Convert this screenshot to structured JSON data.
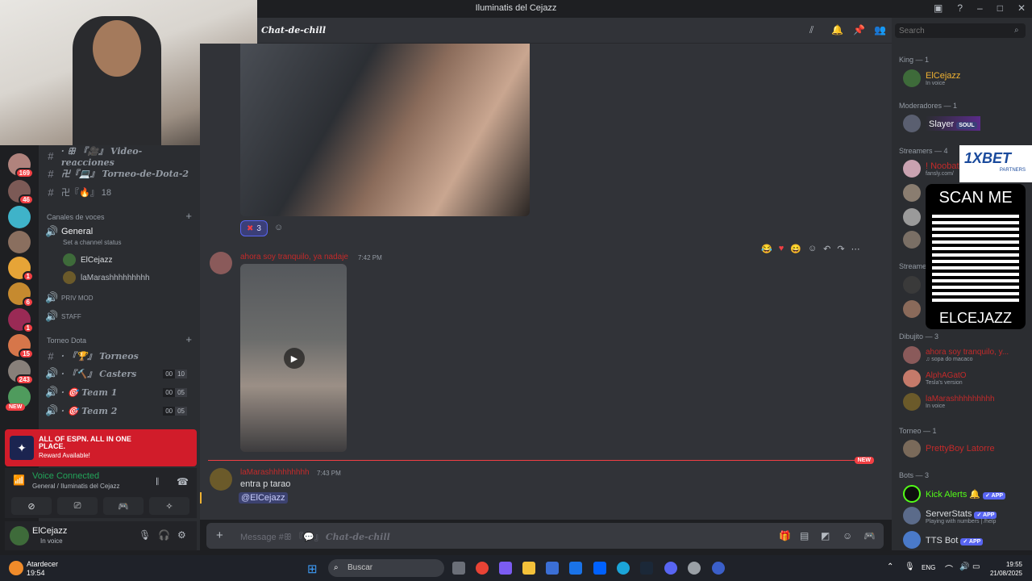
{
  "window": {
    "title": "Iluminatis del Cejazz"
  },
  "channel": {
    "name": "Chat-de-chill"
  },
  "search": {
    "placeholder": "Search"
  },
  "channels": {
    "top": [
      {
        "label": "· ꕥ 『🎥』 Video-reacciones"
      },
      {
        "label": "卍『💻』 Torneo-de-Dota-2"
      },
      {
        "label": "卍『🔥』 18"
      }
    ],
    "voice_category": "Canales de voces",
    "general": {
      "label": "General",
      "status": "Set a channel status"
    },
    "voice_users": [
      "ElCejazz",
      "laMarashhhhhhhhh"
    ],
    "priv_mod": "PRIV MOD",
    "staff": "STAFF",
    "dota_category": "Torneo Dota",
    "dota": [
      {
        "label": "· 『🏆』 Torneos",
        "count": null
      },
      {
        "label": "· 『🔨』 Casters",
        "count": [
          "00",
          "10"
        ]
      },
      {
        "label": "· 🎯 Team 1",
        "count": [
          "00",
          "05"
        ]
      },
      {
        "label": "· 🎯 Team 2",
        "count": [
          "00",
          "05"
        ]
      }
    ]
  },
  "servers": {
    "badges": [
      "169",
      "46",
      "1",
      "6",
      "1",
      "15",
      "243"
    ],
    "new_label": "NEW"
  },
  "espn": {
    "line1": "ALL OF ESPN. ALL IN ONE PLACE.",
    "line2": "Reward Available!"
  },
  "voice": {
    "status": "Voice Connected",
    "location": "General / Iluminatis del Cejazz"
  },
  "user": {
    "name": "ElCejazz",
    "status": "In voice"
  },
  "messages": {
    "reaction_count": "3",
    "msg1": {
      "author": "ahora soy tranquilo, ya nadaje",
      "time": "7:42 PM"
    },
    "msg2": {
      "author": "laMarashhhhhhhhh",
      "time": "7:43 PM",
      "text": "entra p tarao",
      "mention": "@ElCejazz"
    },
    "new_label": "NEW"
  },
  "composer": {
    "placeholder_prefix": "Message #ꕥ 『💬』 ",
    "placeholder_channel": "Chat-de-chill"
  },
  "members": {
    "king": {
      "header": "King — 1",
      "name": "ElCejazz",
      "sub": "In voice"
    },
    "mods": {
      "header": "Moderadores — 1",
      "name": "Slayer",
      "tag": "SOUL"
    },
    "streamers": {
      "header": "Streamers — 4",
      "first": "! Noobat",
      "first_sub": "fansly.com/"
    },
    "streamers2": {
      "header": "Streame"
    },
    "dibujito": {
      "header": "Dibujito — 3",
      "items": [
        {
          "name": "ahora soy tranquilo, y...",
          "sub": "♫ sopa do macaco"
        },
        {
          "name": "AlphAGatO",
          "sub": "Tesla's version"
        },
        {
          "name": "laMarashhhhhhhhh",
          "sub": "In voice"
        }
      ]
    },
    "torneo": {
      "header": "Torneo — 1",
      "name": "PrettyBoy Latorre"
    },
    "bots": {
      "header": "Bots — 3",
      "items": [
        {
          "name": "Kick Alerts 🔔",
          "sub": "",
          "tag": "✓ APP"
        },
        {
          "name": "ServerStats",
          "sub": "Playing with numbers | /help",
          "tag": "✓ APP"
        },
        {
          "name": "TTS Bot",
          "sub": "",
          "tag": "✓ APP"
        }
      ]
    }
  },
  "overlay": {
    "scan": "SCAN ME",
    "user": "ELCEJAZZ",
    "brand": "1XBET",
    "brand_sub": "PARTNERS"
  },
  "taskbar": {
    "weather": "Atardecer",
    "weather_time": "19:54",
    "search": "Buscar",
    "lang": "ENG",
    "time": "19:55",
    "date": "21/08/2025"
  },
  "colors": {
    "accent": "#5865f2",
    "online": "#23a55a",
    "danger": "#f23f43",
    "bg": "#313338"
  }
}
